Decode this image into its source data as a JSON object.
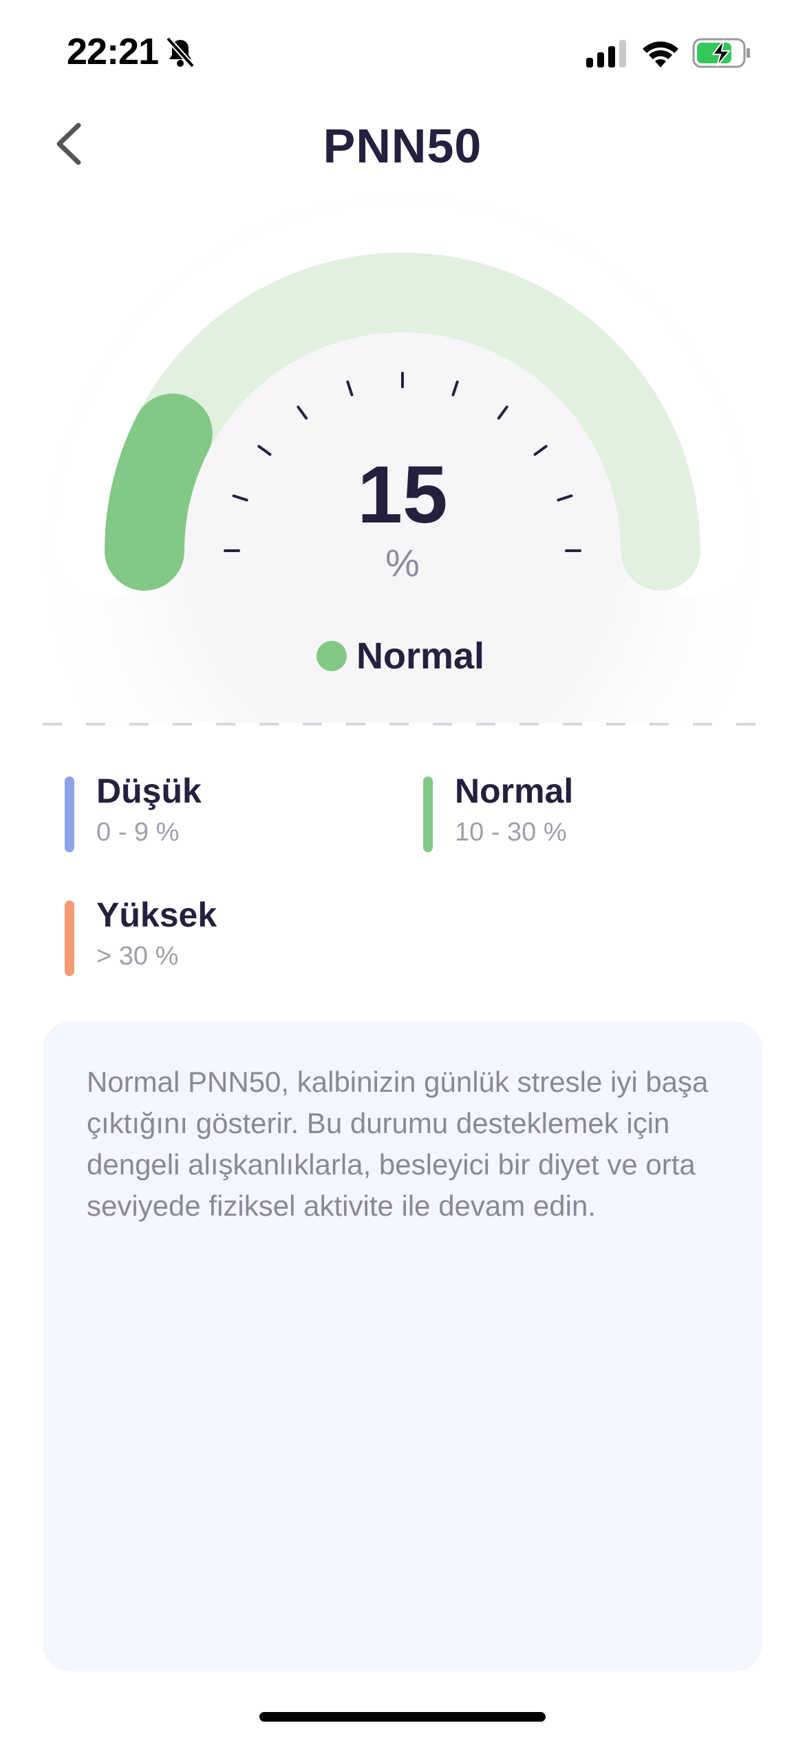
{
  "status_bar": {
    "time": "22:21",
    "silent_icon": "bell-slash-icon",
    "signal_icon": "cellular-signal-icon",
    "wifi_icon": "wifi-icon",
    "battery_icon": "battery-charging-icon"
  },
  "header": {
    "title": "PNN50",
    "back_icon": "chevron-left-icon"
  },
  "gauge": {
    "value": "15",
    "unit": "%",
    "fill_fraction": 0.15,
    "status_label": "Normal",
    "colors": {
      "track": "#e2f0e0",
      "fill": "#83c886",
      "ticks": "#24213f"
    }
  },
  "legend": [
    {
      "label": "Düşük",
      "range": "0 - 9 %",
      "color": "#8ea3ea"
    },
    {
      "label": "Normal",
      "range": "10 - 30 %",
      "color": "#83c886"
    },
    {
      "label": "Yüksek",
      "range": "> 30 %",
      "color": "#f59a72"
    }
  ],
  "info": {
    "text": "Normal PNN50, kalbinizin günlük stresle iyi başa çıktığını gösterir. Bu durumu desteklemek için dengeli alışkanlıklarla, besleyici bir diyet ve orta seviyede fiziksel aktivite ile devam edin."
  }
}
